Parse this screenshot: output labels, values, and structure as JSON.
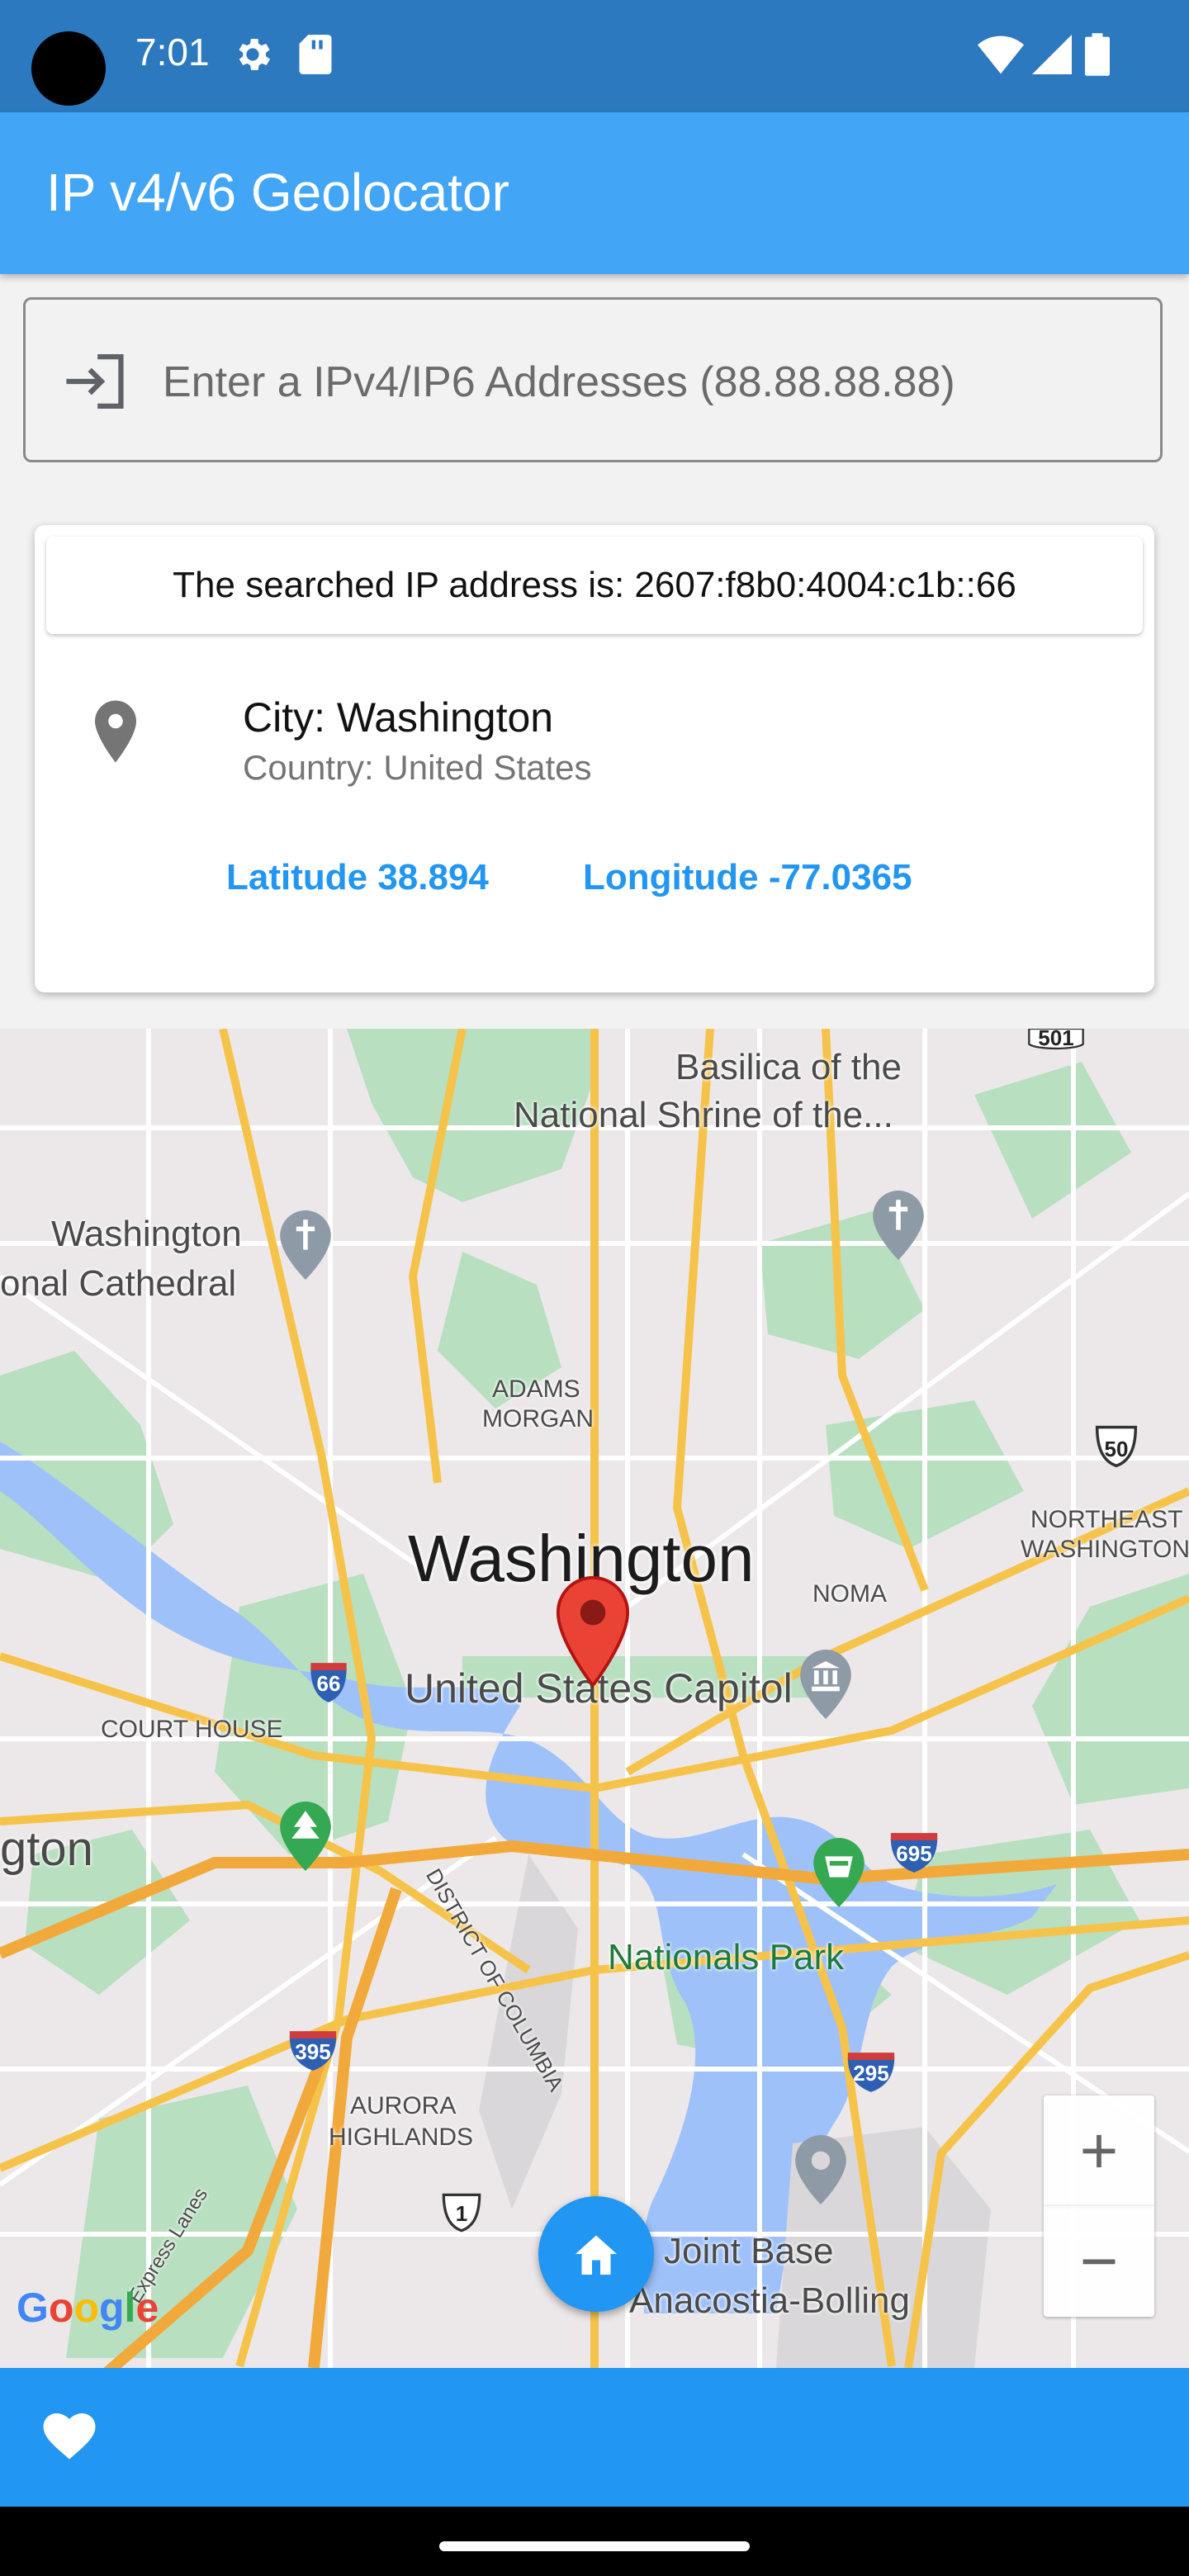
{
  "status_bar": {
    "time": "7:01",
    "icons": [
      "settings-icon",
      "sd-card-icon",
      "wifi-icon",
      "signal-icon",
      "battery-icon"
    ]
  },
  "app_bar": {
    "title": "IP v4/v6 Geolocator",
    "color": "#42a5f5"
  },
  "search": {
    "placeholder": "Enter a IPv4/IP6 Addresses (88.88.88.88)",
    "value": "",
    "icon": "login-icon"
  },
  "result_card": {
    "searched_label": "The searched IP address is: 2607:f8b0:4004:c1b::66",
    "city": "City: Washington",
    "country": "Country: United States",
    "latitude": "Latitude 38.894",
    "longitude": "Longitude -77.0365",
    "icon": "location-pin-icon",
    "accent_color": "#2196f3"
  },
  "map": {
    "labels": {
      "basilica": "Basilica of the",
      "national_shrine": "National Shrine of the...",
      "washington_nc": "Washington",
      "national_cathedral": "onal Cathedral",
      "adams": "ADAMS",
      "morgan": "MORGAN",
      "northeast": "NORTHEAST",
      "northeast_washington": "WASHINGTON",
      "washington": "Washington",
      "noma": "NOMA",
      "capitol": "United States Capitol",
      "court_house": "COURT HOUSE",
      "arlington": "gton",
      "nationals_park": "Nationals Park",
      "district": "DISTRICT OF COLUMBIA",
      "aurora": "AURORA",
      "highlands": "HIGHLANDS",
      "joint_base": "Joint Base",
      "anacostia": "Anacostia-Bolling",
      "express_lanes": "Express Lanes",
      "google": "Google"
    },
    "shields": {
      "i66": "66",
      "i395": "395",
      "i695": "695",
      "i295": "295",
      "us50": "50",
      "us1": "1",
      "r501": "501"
    },
    "zoom_in": "+",
    "zoom_out": "−",
    "marker_color": "#ea4335"
  },
  "bottom_bar": {
    "color": "#2196f3",
    "left_icon": "heart-icon",
    "fab_icon": "home-icon"
  }
}
